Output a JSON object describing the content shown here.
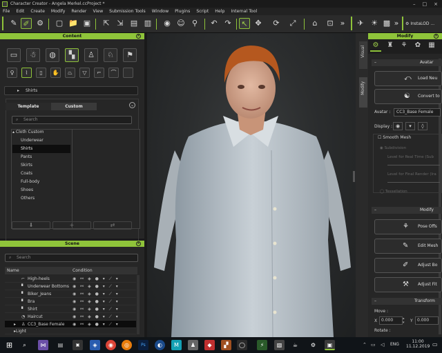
{
  "window": {
    "title": "Character Creator - Angela Merkel.ccProject *",
    "controls": [
      "–",
      "□",
      "×"
    ]
  },
  "menu": [
    "File",
    "Edit",
    "Create",
    "Modify",
    "Render",
    "View",
    "Submission Tools",
    "Window",
    "Plugins",
    "Script",
    "Help",
    "Internal Tool"
  ],
  "toolbar": {
    "overflow": "»",
    "insta_lod": "InstaLOD ..."
  },
  "content_panel": {
    "title": "Content",
    "path": "Shirts",
    "tabs": [
      "Template",
      "Custom"
    ],
    "search_placeholder": "Search",
    "tree_root": "Cloth Custom",
    "tree_items": [
      "Underwear",
      "Shirts",
      "Pants",
      "Skirts",
      "Coats",
      "Full-body",
      "Shoes",
      "Others"
    ],
    "selected_item": "Shirts"
  },
  "scene_panel": {
    "title": "Scene",
    "search_placeholder": "Search",
    "columns": [
      "Name",
      "Condition"
    ],
    "rows": [
      {
        "name": "High-heels"
      },
      {
        "name": "Underwear Bottoms"
      },
      {
        "name": "Biker_Jeans"
      },
      {
        "name": "Bra"
      },
      {
        "name": "Shirt"
      },
      {
        "name": "Haircut"
      },
      {
        "name": "CC3_Base Female"
      }
    ],
    "next_row": "Light"
  },
  "modify_panel": {
    "title": "Modify",
    "side_tabs": [
      "Visual",
      "Modify"
    ],
    "avatar_section": "Avatar",
    "load_button": "Load Neu",
    "convert_button": "Convert to",
    "avatar_label": "Avatar :",
    "avatar_value": "CC3_Base Female",
    "display_label": "Display :",
    "smooth_mesh": "Smooth Mesh",
    "subdivision": "Subdivision",
    "level_realtime": "Level for Real Time (Sub",
    "level_final": "Level for Final Render (Ira",
    "tessellation": "Tessellation",
    "modify_section": "Modify",
    "pose_button": "Pose Offs",
    "edit_mesh_button": "Edit Mesh",
    "adjust_bones_button": "Adjust Bo",
    "adjust_fit_button": "Adjust Fit",
    "transform_section": "Transform",
    "move_label": "Move :",
    "x_label": "X",
    "x_value": "0.000",
    "y_label": "Y",
    "y_value": "0.000",
    "rotate_label": "Rotate :"
  },
  "taskbar": {
    "search_icon": "⌕",
    "lang": "ENG",
    "time": "11:00",
    "date": "11.12.2019"
  }
}
